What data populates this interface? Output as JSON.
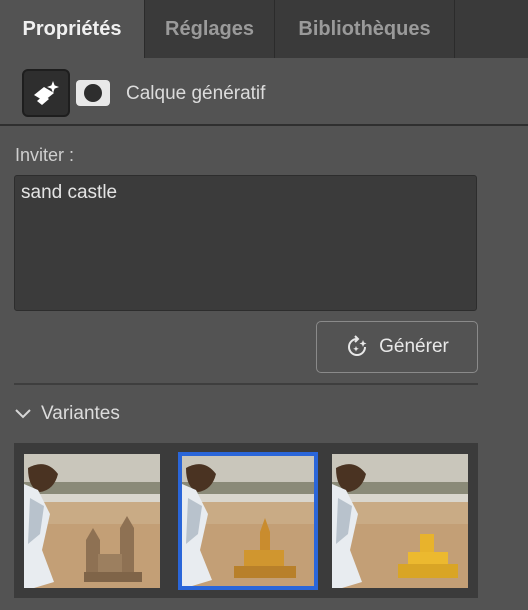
{
  "tabs": [
    {
      "label": "Propriétés",
      "active": true
    },
    {
      "label": "Réglages",
      "active": false
    },
    {
      "label": "Bibliothèques",
      "active": false
    }
  ],
  "layer": {
    "type_icon": "generative-layer-icon",
    "mask_icon": "layer-mask-icon",
    "name": "Calque génératif"
  },
  "prompt": {
    "label": "Inviter :",
    "value": "sand castle"
  },
  "generate_button": {
    "label": "Générer",
    "icon": "regenerate-sparkle-icon"
  },
  "variants": {
    "label": "Variantes",
    "expanded": true,
    "selected_index": 1,
    "items": [
      {
        "description": "beach-photo-variant-1"
      },
      {
        "description": "beach-photo-variant-2"
      },
      {
        "description": "beach-photo-variant-3"
      }
    ]
  },
  "colors": {
    "panel_bg": "#535353",
    "tab_bar_bg": "#3a3a3a",
    "field_bg": "#3b3b3b",
    "selection_border": "#2a66d9"
  }
}
